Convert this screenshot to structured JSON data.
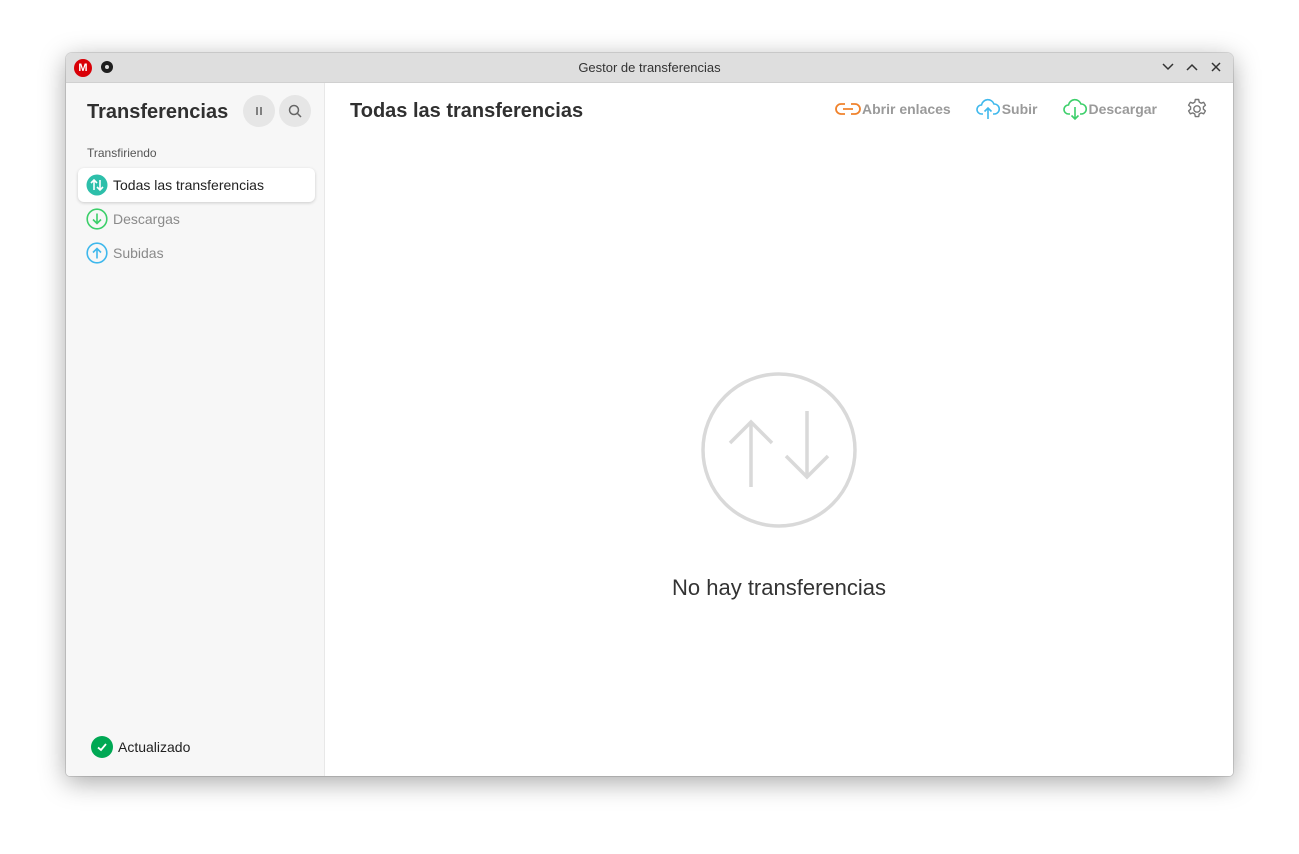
{
  "window": {
    "title": "Gestor de transferencias",
    "logo_letter": "M"
  },
  "sidebar": {
    "title": "Transferencias",
    "section": "Transfiriendo",
    "items": [
      {
        "label": "Todas las transferencias",
        "icon": "transfer-arrows-icon",
        "color": "#2dbfaa",
        "active": true
      },
      {
        "label": "Descargas",
        "icon": "download-circle-icon",
        "color": "#3ccf6a",
        "active": false
      },
      {
        "label": "Subidas",
        "icon": "upload-circle-icon",
        "color": "#3fb8ec",
        "active": false
      }
    ],
    "status": "Actualizado"
  },
  "main": {
    "title": "Todas las transferencias",
    "actions": [
      {
        "label": "Abrir enlaces",
        "icon": "link-icon",
        "color": "#f0822c"
      },
      {
        "label": "Subir",
        "icon": "cloud-upload-icon",
        "color": "#3fb8ec"
      },
      {
        "label": "Descargar",
        "icon": "cloud-download-icon",
        "color": "#3ccf6a"
      }
    ],
    "empty_text": "No hay transferencias"
  }
}
